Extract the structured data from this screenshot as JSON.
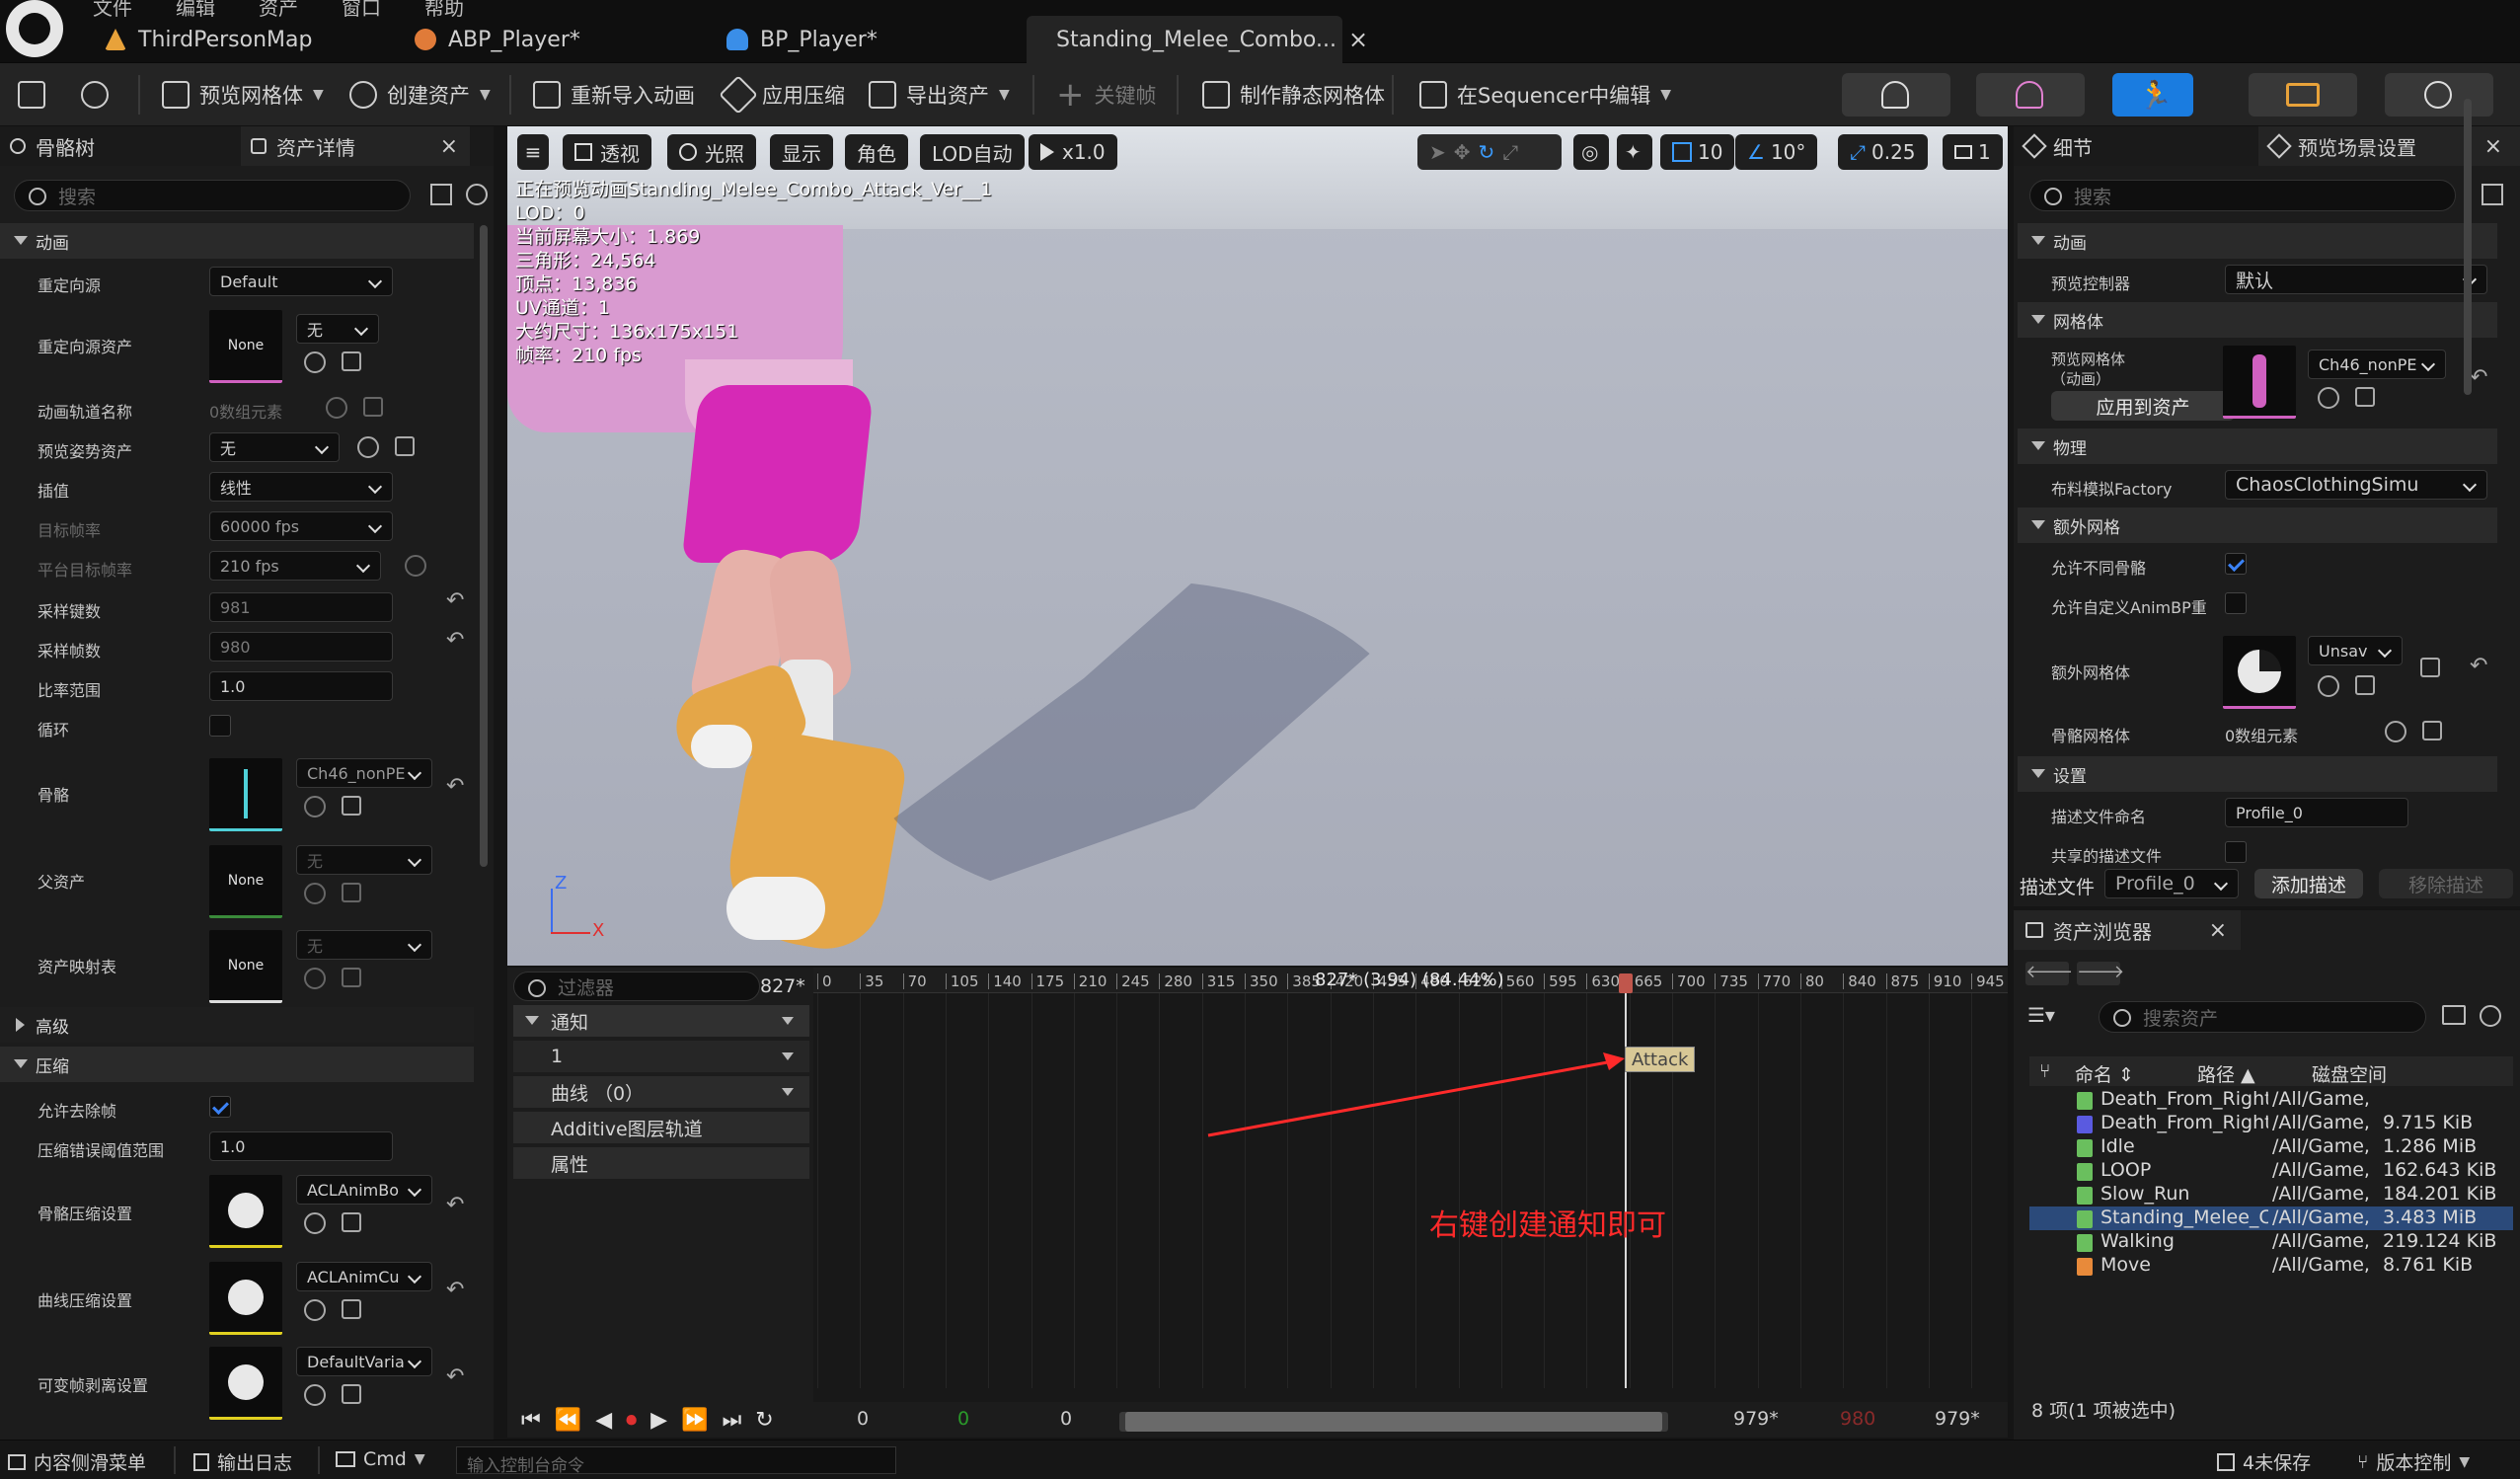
{
  "window": {
    "menu": [
      "文件",
      "编辑",
      "资产",
      "窗口",
      "帮助"
    ],
    "tabs": [
      {
        "label": "ThirdPersonMap",
        "icon": "level-icon",
        "color": "#e8a23a"
      },
      {
        "label": "ABP_Player*",
        "icon": "animbp-icon",
        "color": "#e07b39"
      },
      {
        "label": "BP_Player*",
        "icon": "blueprint-icon",
        "color": "#3a8ee8"
      },
      {
        "label": "Standing_Melee_Combo...",
        "icon": "animsequence-icon",
        "color": "#6abf5e",
        "close": "×"
      }
    ]
  },
  "toolbar": {
    "preview_mesh": "预览网格体",
    "create_asset": "创建资产",
    "reimport": "重新导入动画",
    "apply_compression": "应用压缩",
    "export_asset": "导出资产",
    "keyframe": "关键帧",
    "make_static_mesh": "制作静态网格体",
    "edit_in_sequencer": "在Sequencer中编辑"
  },
  "left_panel": {
    "tab1": "骨骼树",
    "tab2": "资产详情",
    "close": "×",
    "search_placeholder": "搜索",
    "cat_anim": "动画",
    "retarget_source": {
      "label": "重定向源",
      "value": "Default"
    },
    "retarget_asset": {
      "label": "重定向源资产",
      "thumb": "None",
      "value": "无"
    },
    "track_names": {
      "label": "动画轨道名称",
      "value": "0数组元素"
    },
    "pose_asset": {
      "label": "预览姿势资产",
      "value": "无"
    },
    "interp": {
      "label": "插值",
      "value": "线性"
    },
    "target_rate": {
      "label": "目标帧率",
      "value": "60000 fps"
    },
    "platform_rate": {
      "label": "平台目标帧率",
      "value": "210 fps"
    },
    "sample_keys": {
      "label": "采样键数",
      "value": "981"
    },
    "sample_frames": {
      "label": "采样帧数",
      "value": "980"
    },
    "rate_scale": {
      "label": "比率范围",
      "value": "1.0"
    },
    "loop": {
      "label": "循环"
    },
    "skeleton": {
      "label": "骨骼",
      "value": "Ch46_nonPE"
    },
    "parent_asset": {
      "label": "父资产",
      "thumb": "None",
      "value": "无"
    },
    "asset_mapping": {
      "label": "资产映射表",
      "thumb": "None",
      "value": "无"
    },
    "cat_advanced": "高级",
    "cat_compression": "压缩",
    "allow_strip": {
      "label": "允许去除帧"
    },
    "error_threshold": {
      "label": "压缩错误阈值范围",
      "value": "1.0"
    },
    "bone_compression": {
      "label": "骨骼压缩设置",
      "value": "ACLAnimBo"
    },
    "curve_compression": {
      "label": "曲线压缩设置",
      "value": "ACLAnimCu"
    },
    "variable_frame": {
      "label": "可变帧剥离设置",
      "value": "DefaultVaria"
    }
  },
  "viewport": {
    "menu": "≡",
    "perspective": "透视",
    "lit": "光照",
    "show": "显示",
    "character": "角色",
    "lod": "LOD自动",
    "play_rate": "x1.0",
    "grid_snap": "10",
    "rot_snap": "10°",
    "scale_snap": "0.25",
    "cam_speed": "1",
    "info": [
      "正在预览动画Standing_Melee_Combo_Attack_Ver__1",
      "LOD：0",
      "当前屏幕大小：1.869",
      "三角形：24,564",
      "顶点：13,836",
      "UV通道：1",
      "大约尺寸：136x175x151",
      "帧率：210 fps"
    ],
    "axis_z": "Z",
    "axis_x": "X"
  },
  "sequencer": {
    "filter_placeholder": "过滤器",
    "frame_field": "827*",
    "playhead_readout": "827* (3.94) (84.44%)",
    "tracks": {
      "notify": "通知",
      "notify_track": "1",
      "curves": "曲线 （0）",
      "additive": "Additive图层轨道",
      "attributes": "属性"
    },
    "ticks": [
      "0",
      "35",
      "70",
      "105",
      "140",
      "175",
      "210",
      "245",
      "280",
      "315",
      "350",
      "385",
      "420",
      "455",
      "490",
      "525",
      "560",
      "595",
      "630",
      "665",
      "700",
      "735",
      "770",
      "80",
      "840",
      "875",
      "910",
      "945"
    ],
    "notify_label": "Attack",
    "annotation": "右键创建通知即可",
    "bottom": {
      "start": "0",
      "green": "0",
      "mid": "0",
      "end1": "979*",
      "red": "980",
      "end2": "979*"
    },
    "colors": {
      "annotation": "#ff2a2a",
      "playhead": "#c0564c",
      "notify": "#d8c896"
    }
  },
  "right_panel": {
    "tab1": "细节",
    "tab2": "预览场景设置",
    "close": "×",
    "search_placeholder": "搜索",
    "cat_anim": "动画",
    "preview_controller": {
      "label": "预览控制器",
      "value": "默认"
    },
    "cat_mesh": "网格体",
    "preview_mesh": {
      "label": "预览网格体\n（动画）",
      "value": "Ch46_nonPE",
      "button": "应用到资产"
    },
    "cat_physics": "物理",
    "cloth_factory": {
      "label": "布料模拟Factory",
      "value": "ChaosClothingSimu"
    },
    "cat_extra_mesh": "额外网格",
    "allow_diff_skel": {
      "label": "允许不同骨骼"
    },
    "allow_custom_bp": {
      "label": "允许自定义AnimBP重"
    },
    "extra_mesh": {
      "label": "额外网格体",
      "value": "Unsav"
    },
    "skeletal_meshes": {
      "label": "骨骼网格体",
      "value": "0数组元素"
    },
    "cat_settings": "设置",
    "profile_name": {
      "label": "描述文件命名",
      "value": "Profile_0"
    },
    "shared_profile": {
      "label": "共享的描述文件"
    },
    "profile_bar": {
      "label": "描述文件",
      "value": "Profile_0",
      "add": "添加描述",
      "remove": "移除描述"
    }
  },
  "content_browser": {
    "title": "资产浏览器",
    "close": "×",
    "search_placeholder": "搜索资产",
    "columns": {
      "name": "命名",
      "path": "路径",
      "size": "磁盘空间"
    },
    "rows": [
      {
        "name": "Death_From_Right",
        "path": "/All/Game,",
        "size": "",
        "color": "#6abf5e"
      },
      {
        "name": "Death_From_Right",
        "path": "/All/Game,",
        "size": "9.715 KiB",
        "color": "#5a5ae0"
      },
      {
        "name": "Idle",
        "path": "/All/Game,",
        "size": "1.286 MiB",
        "color": "#6abf5e"
      },
      {
        "name": "LOOP",
        "path": "/All/Game,",
        "size": "162.643 KiB",
        "color": "#6abf5e"
      },
      {
        "name": "Slow_Run",
        "path": "/All/Game,",
        "size": "184.201 KiB",
        "color": "#6abf5e"
      },
      {
        "name": "Standing_Melee_Co",
        "path": "/All/Game,",
        "size": "3.483 MiB",
        "color": "#6abf5e",
        "selected": true
      },
      {
        "name": "Walking",
        "path": "/All/Game,",
        "size": "219.124 KiB",
        "color": "#6abf5e"
      },
      {
        "name": "Move",
        "path": "/All/Game,",
        "size": "8.761 KiB",
        "color": "#e88a3a"
      }
    ],
    "footer": "8 项(1 项被选中)"
  },
  "statusbar": {
    "content_drawer": "内容侧滑菜单",
    "output_log": "输出日志",
    "cmd": "Cmd",
    "console_placeholder": "输入控制台命令",
    "unsaved": "4未保存",
    "source_control": "版本控制"
  }
}
